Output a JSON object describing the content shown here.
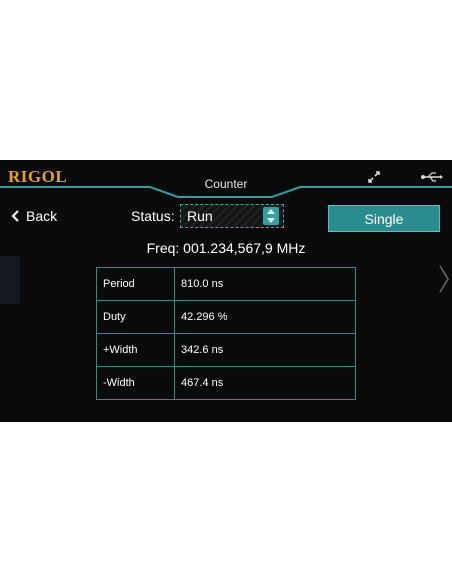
{
  "header": {
    "logo": "RIGOL",
    "title": "Counter",
    "icons": [
      "connection-icon",
      "usb-icon"
    ]
  },
  "toolbar": {
    "back_label": "Back",
    "status_label": "Status:",
    "status_value": "Run",
    "single_label": "Single"
  },
  "frequency": {
    "text": "Freq: 001.234,567,9 MHz"
  },
  "measurements": [
    {
      "name": "Period",
      "value": "810.0 ns"
    },
    {
      "name": "Duty",
      "value": "42.296 %"
    },
    {
      "name": "+Width",
      "value": "342.6 ns"
    },
    {
      "name": "-Width",
      "value": "467.4 ns"
    }
  ],
  "colors": {
    "accent": "#2fa3a3",
    "logo": "#e8a317",
    "background": "#0a0a0a"
  }
}
